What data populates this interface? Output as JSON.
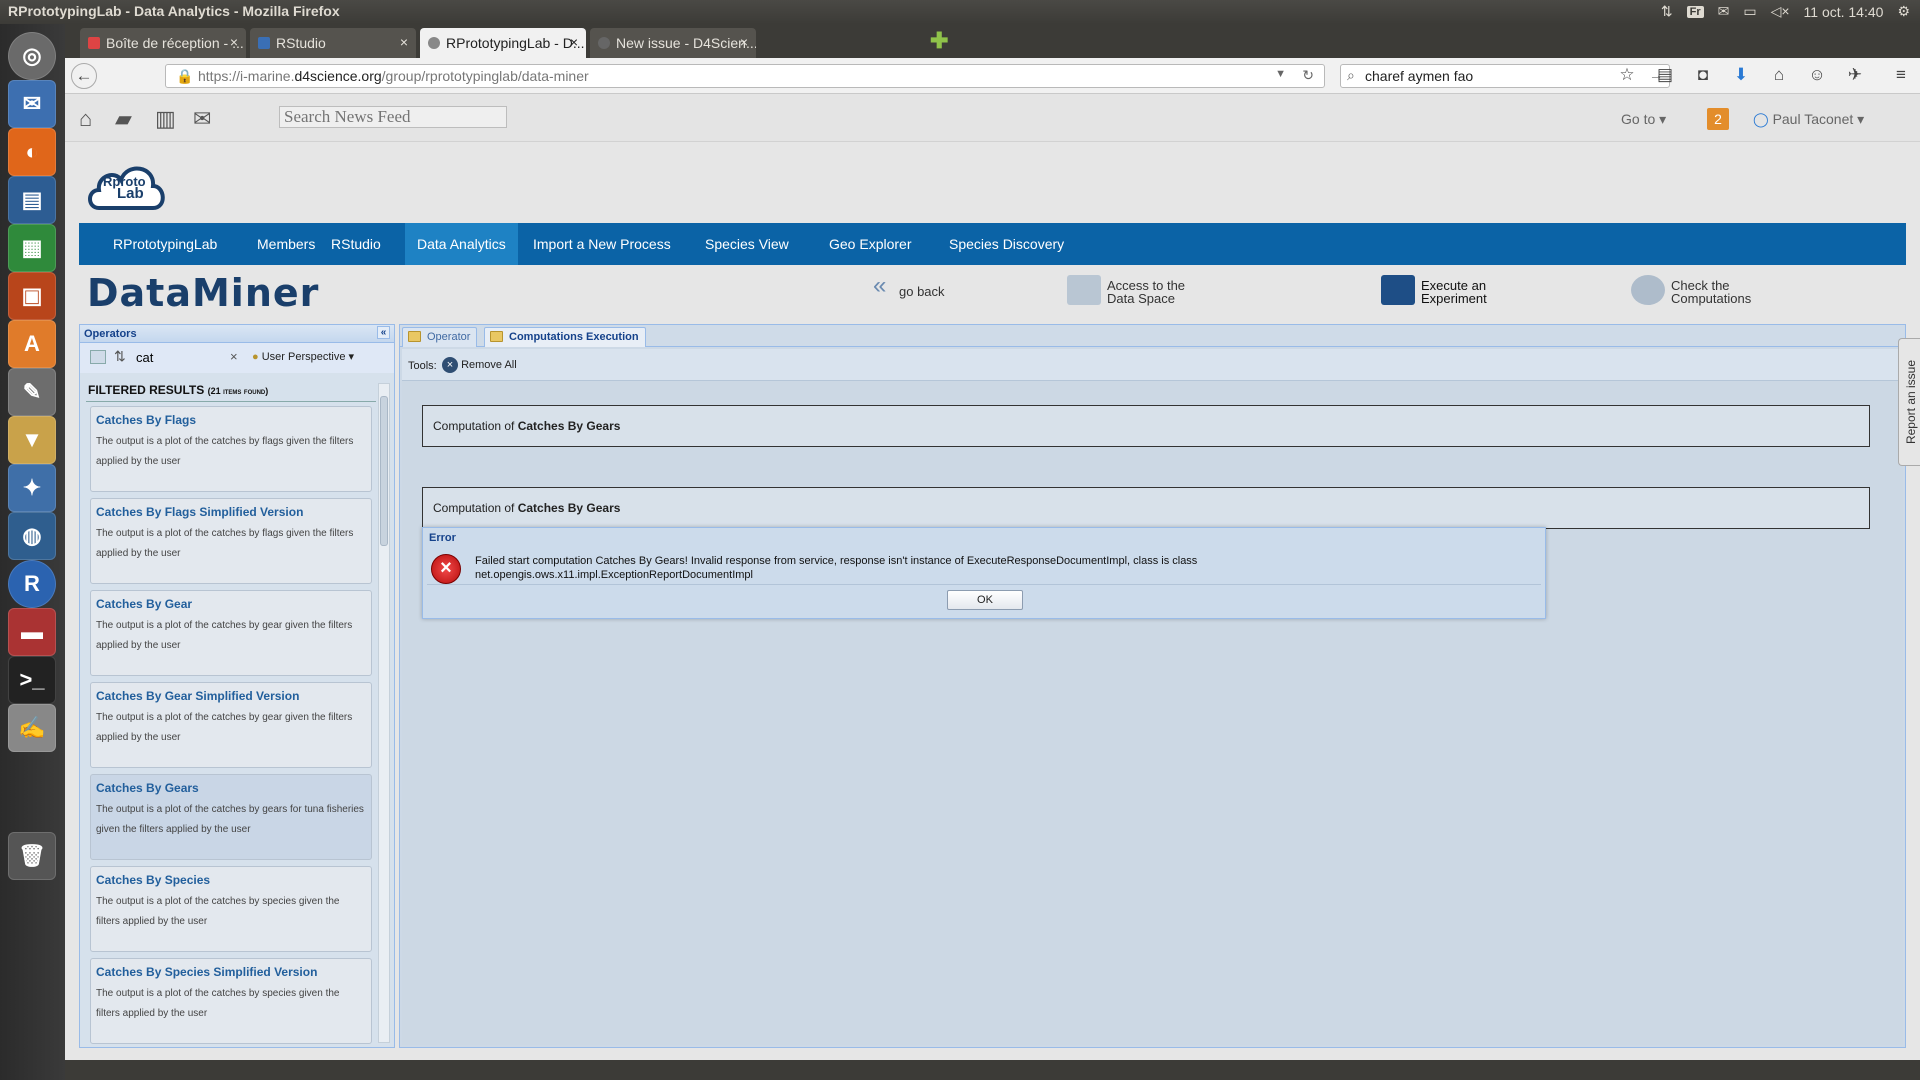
{
  "window": {
    "title": "RPrototypingLab - Data Analytics - Mozilla Firefox"
  },
  "tray": {
    "keyboard": "Fr",
    "datetime": "11 oct. 14:40"
  },
  "tabs": [
    {
      "label": "Boîte de réception - ...",
      "color": "#d44"
    },
    {
      "label": "RStudio",
      "color": "#3a6fb5"
    },
    {
      "label": "RPrototypingLab - D...",
      "color": "#888"
    },
    {
      "label": "New issue - D4Scien...",
      "color": "#666"
    }
  ],
  "nav": {
    "url_prefix": "https://i-marine.",
    "url_domain": "d4science.org",
    "url_suffix": "/group/rprototypinglab/data-miner",
    "search_value": "charef aymen fao"
  },
  "portal": {
    "search_placeholder": "Search News Feed",
    "goto_label": "Go to",
    "notifications": "2",
    "user_name": "Paul Taconet"
  },
  "logo": {
    "line1": "Rproto",
    "line2": "Lab"
  },
  "menu": [
    {
      "label": "RPrototypingLab"
    },
    {
      "label": "Members"
    },
    {
      "label": "RStudio"
    },
    {
      "label": "Data Analytics"
    },
    {
      "label": "Import a New Process"
    },
    {
      "label": "Species View"
    },
    {
      "label": "Geo Explorer"
    },
    {
      "label": "Species Discovery"
    }
  ],
  "dataminer": {
    "logo_text": "DataMiner",
    "go_back": "go back",
    "access_l1": "Access to the",
    "access_l2": "Data Space",
    "execute_l1": "Execute an",
    "execute_l2": "Experiment",
    "check_l1": "Check the",
    "check_l2": "Computations"
  },
  "operators": {
    "header": "Operators",
    "search_value": "cat",
    "perspective": "User Perspective",
    "filtered_label": "Filtered results",
    "items_found": "(21 items found)",
    "items": [
      {
        "title": "Catches By Flags",
        "desc": "The output is a plot of the catches by flags given the filters applied by the user"
      },
      {
        "title": "Catches By Flags Simplified Version",
        "desc": "The output is a plot of the catches by flags given the filters applied by the user"
      },
      {
        "title": "Catches By Gear",
        "desc": "The output is a plot of the catches by gear given the filters applied by the user"
      },
      {
        "title": "Catches By Gear Simplified Version",
        "desc": "The output is a plot of the catches by gear given the filters applied by the user"
      },
      {
        "title": "Catches By Gears",
        "desc": "The output is a plot of the catches by gears for tuna fisheries given the filters applied by the user"
      },
      {
        "title": "Catches By Species",
        "desc": "The output is a plot of the catches by species given the filters applied by the user"
      },
      {
        "title": "Catches By Species Simplified Version",
        "desc": "The output is a plot of the catches by species given the filters applied by the user"
      }
    ]
  },
  "execution": {
    "tab_operator": "Operator",
    "tab_computations": "Computations Execution",
    "tools_label": "Tools:",
    "remove_all": "Remove All",
    "computations": [
      {
        "prefix": "Computation of ",
        "name": "Catches By Gears"
      },
      {
        "prefix": "Computation of ",
        "name": "Catches By Gears"
      }
    ],
    "error": {
      "title": "Error",
      "message_l1": "Failed start computation Catches By Gears! Invalid response from service, response isn't instance of ExecuteResponseDocumentImpl, class is class",
      "message_l2": "net.opengis.ows.x11.impl.ExceptionReportDocumentImpl",
      "ok": "OK"
    }
  },
  "report_issue": "Report an issue"
}
